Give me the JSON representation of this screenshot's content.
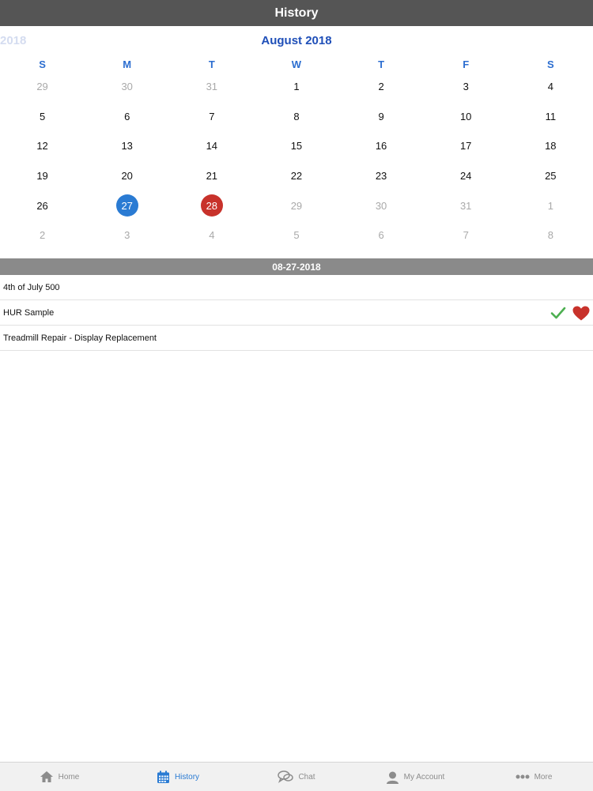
{
  "header": {
    "title": "History"
  },
  "calendar": {
    "prev_month_label": "2018",
    "month_title": "August 2018",
    "weekdays": [
      "S",
      "M",
      "T",
      "W",
      "T",
      "F",
      "S"
    ],
    "days": [
      {
        "d": "29",
        "muted": true
      },
      {
        "d": "30",
        "muted": true
      },
      {
        "d": "31",
        "muted": true
      },
      {
        "d": "1"
      },
      {
        "d": "2"
      },
      {
        "d": "3"
      },
      {
        "d": "4"
      },
      {
        "d": "5"
      },
      {
        "d": "6"
      },
      {
        "d": "7"
      },
      {
        "d": "8"
      },
      {
        "d": "9"
      },
      {
        "d": "10"
      },
      {
        "d": "11"
      },
      {
        "d": "12"
      },
      {
        "d": "13"
      },
      {
        "d": "14"
      },
      {
        "d": "15"
      },
      {
        "d": "16"
      },
      {
        "d": "17"
      },
      {
        "d": "18"
      },
      {
        "d": "19"
      },
      {
        "d": "20"
      },
      {
        "d": "21"
      },
      {
        "d": "22"
      },
      {
        "d": "23"
      },
      {
        "d": "24"
      },
      {
        "d": "25"
      },
      {
        "d": "26"
      },
      {
        "d": "27",
        "state": "selected"
      },
      {
        "d": "28",
        "state": "today"
      },
      {
        "d": "29",
        "muted": true
      },
      {
        "d": "30",
        "muted": true
      },
      {
        "d": "31",
        "muted": true
      },
      {
        "d": "1",
        "muted": true
      },
      {
        "d": "2",
        "muted": true
      },
      {
        "d": "3",
        "muted": true
      },
      {
        "d": "4",
        "muted": true
      },
      {
        "d": "5",
        "muted": true
      },
      {
        "d": "6",
        "muted": true
      },
      {
        "d": "7",
        "muted": true
      },
      {
        "d": "8",
        "muted": true
      }
    ],
    "colors": {
      "selected": "#2a7bd3",
      "today": "#c8322b",
      "title": "#1f4fb8"
    }
  },
  "selected_date": "08-27-2018",
  "workouts": [
    {
      "name": "4th of July 500",
      "completed": false,
      "favorite": false
    },
    {
      "name": "HUR Sample",
      "completed": true,
      "favorite": true,
      "icons": [
        "check-icon",
        "heart-icon"
      ]
    },
    {
      "name": "Treadmill Repair - Display Replacement",
      "completed": false,
      "favorite": false
    }
  ],
  "tabbar": {
    "items": [
      {
        "label": "Home",
        "icon": "home-icon"
      },
      {
        "label": "History",
        "icon": "calendar-icon",
        "active": true
      },
      {
        "label": "Chat",
        "icon": "chat-icon"
      },
      {
        "label": "My Account",
        "icon": "account-icon"
      },
      {
        "label": "More",
        "icon": "more-icon"
      }
    ]
  }
}
